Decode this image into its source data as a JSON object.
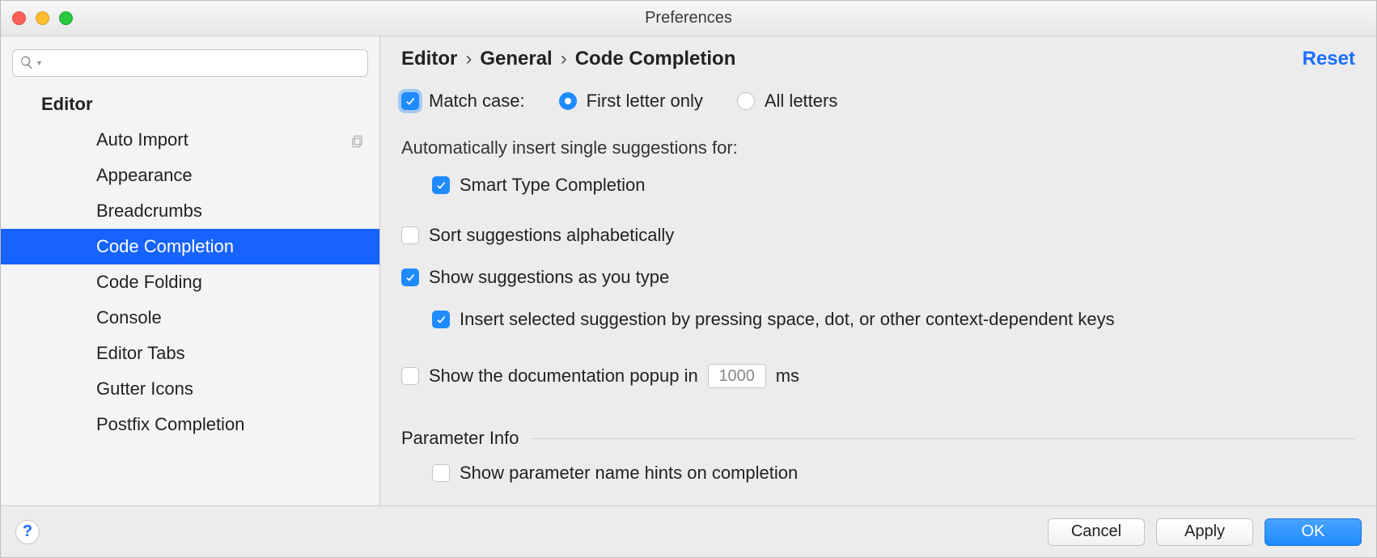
{
  "window": {
    "title": "Preferences"
  },
  "sidebar": {
    "search_placeholder": "",
    "header": "Editor",
    "items": [
      {
        "label": "Auto Import",
        "has_trailing_icon": true
      },
      {
        "label": "Appearance"
      },
      {
        "label": "Breadcrumbs"
      },
      {
        "label": "Code Completion",
        "selected": true
      },
      {
        "label": "Code Folding"
      },
      {
        "label": "Console"
      },
      {
        "label": "Editor Tabs"
      },
      {
        "label": "Gutter Icons"
      },
      {
        "label": "Postfix Completion"
      }
    ]
  },
  "breadcrumb": {
    "parts": [
      "Editor",
      "General",
      "Code Completion"
    ],
    "reset": "Reset"
  },
  "settings": {
    "match_case_label": "Match case:",
    "match_case_checked": true,
    "match_case_options": {
      "first_letter": "First letter only",
      "all_letters": "All letters",
      "selected": "first_letter"
    },
    "auto_insert_label": "Automatically insert single suggestions for:",
    "smart_type_label": "Smart Type Completion",
    "smart_type_checked": true,
    "sort_alpha_label": "Sort suggestions alphabetically",
    "sort_alpha_checked": false,
    "show_suggestions_label": "Show suggestions as you type",
    "show_suggestions_checked": true,
    "insert_by_keys_label": "Insert selected suggestion by pressing space, dot, or other context-dependent keys",
    "insert_by_keys_checked": true,
    "show_doc_popup_label_pre": "Show the documentation popup in",
    "show_doc_popup_value": "1000",
    "show_doc_popup_label_post": "ms",
    "show_doc_popup_checked": false,
    "parameter_info_section": "Parameter Info",
    "param_hints_label": "Show parameter name hints on completion",
    "param_hints_checked": false
  },
  "footer": {
    "cancel": "Cancel",
    "apply": "Apply",
    "ok": "OK"
  }
}
